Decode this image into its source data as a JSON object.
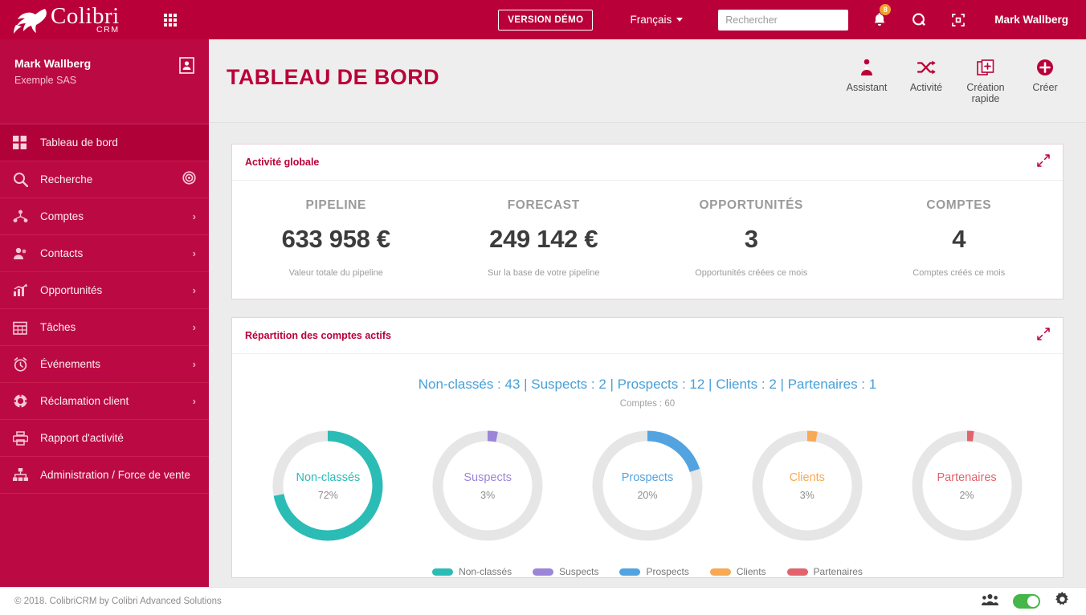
{
  "topbar": {
    "brand_name": "Colibri",
    "brand_sub": "CRM",
    "apps_icon": "grid-apps-icon",
    "demo_badge": "VERSION DÉMO",
    "language": "Français",
    "search": {
      "placeholder": "Rechercher",
      "value": ""
    },
    "notifications_count": "8",
    "user_name": "Mark Wallberg"
  },
  "sidebar": {
    "user_name": "Mark Wallberg",
    "user_org": "Exemple SAS",
    "items": [
      {
        "label": "Tableau de bord",
        "icon": "dashboard-icon",
        "chevron": false,
        "active": true,
        "badge_icon": null
      },
      {
        "label": "Recherche",
        "icon": "search-icon",
        "chevron": false,
        "active": false,
        "badge_icon": "target-icon"
      },
      {
        "label": "Comptes",
        "icon": "accounts-icon",
        "chevron": true,
        "active": false,
        "badge_icon": null
      },
      {
        "label": "Contacts",
        "icon": "contacts-icon",
        "chevron": true,
        "active": false,
        "badge_icon": null
      },
      {
        "label": "Opportunités",
        "icon": "chart-bar-icon",
        "chevron": true,
        "active": false,
        "badge_icon": null
      },
      {
        "label": "Tâches",
        "icon": "calendar-icon",
        "chevron": true,
        "active": false,
        "badge_icon": null
      },
      {
        "label": "Événements",
        "icon": "alarm-clock-icon",
        "chevron": true,
        "active": false,
        "badge_icon": null
      },
      {
        "label": "Réclamation client",
        "icon": "lifebuoy-icon",
        "chevron": true,
        "active": false,
        "badge_icon": null
      },
      {
        "label": "Rapport d'activité",
        "icon": "printer-icon",
        "chevron": false,
        "active": false,
        "badge_icon": null
      },
      {
        "label": "Administration / Force de vente",
        "icon": "sitemap-icon",
        "chevron": false,
        "active": false,
        "badge_icon": null
      }
    ]
  },
  "page": {
    "title": "TABLEAU DE BORD",
    "actions": [
      {
        "label": "Assistant",
        "icon": "assistant-icon"
      },
      {
        "label": "Activité",
        "icon": "shuffle-icon"
      },
      {
        "label": "Création rapide",
        "icon": "quick-create-icon"
      },
      {
        "label": "Créer",
        "icon": "plus-circle-icon"
      }
    ]
  },
  "cards": {
    "activity": {
      "title": "Activité globale",
      "expand_icon": "expand-icon",
      "kpis": [
        {
          "label": "PIPELINE",
          "value": "633 958 €",
          "sub": "Valeur totale du pipeline"
        },
        {
          "label": "FORECAST",
          "value": "249 142 €",
          "sub": "Sur la base de votre pipeline"
        },
        {
          "label": "OPPORTUNITÉS",
          "value": "3",
          "sub": "Opportunités créées ce mois"
        },
        {
          "label": "COMPTES",
          "value": "4",
          "sub": "Comptes créés ce mois"
        }
      ]
    },
    "distribution": {
      "title": "Répartition des comptes actifs",
      "expand_icon": "expand-icon",
      "summary": "Non-classés : 43 | Suspects : 2 | Prospects : 12 | Clients : 2 | Partenaires : 1",
      "total": "Comptes : 60"
    }
  },
  "chart_data": {
    "type": "pie",
    "title": "Répartition des comptes actifs",
    "subtitle": "Comptes : 60",
    "total": 60,
    "legend_position": "bottom",
    "track_color": "#e6e6e6",
    "categories": [
      "Non-classés",
      "Suspects",
      "Prospects",
      "Clients",
      "Partenaires"
    ],
    "values": [
      43,
      2,
      12,
      2,
      1
    ],
    "percent_labels": [
      "72%",
      "3%",
      "20%",
      "3%",
      "2%"
    ],
    "percents": [
      72,
      3,
      20,
      3,
      2
    ],
    "colors": [
      "#2bbcb6",
      "#9b85d8",
      "#52a3e0",
      "#f7a953",
      "#e2636b"
    ]
  },
  "footer": {
    "copyright": "© 2018. ColibriCRM by Colibri Advanced Solutions",
    "users_icon": "users-icon",
    "toggle_on": true,
    "settings_icon": "gear-icon"
  },
  "colors": {
    "brand_red": "#ba0039",
    "sidebar_red": "#bb0a43",
    "accent_blue": "#46a0da",
    "badge_orange": "#f0a12e",
    "toggle_green": "#45b649"
  }
}
